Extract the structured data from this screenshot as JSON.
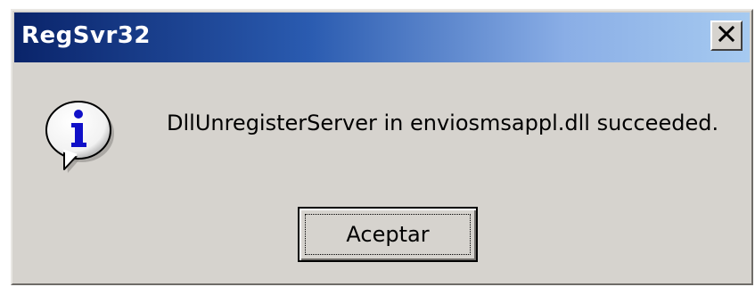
{
  "window": {
    "title": "RegSvr32",
    "close_label": "✕",
    "close_icon": "close-icon"
  },
  "dialog": {
    "icon": "info-icon",
    "message": "DllUnregisterServer in enviosmsappl.dll succeeded.",
    "ok_label": "Aceptar"
  },
  "colors": {
    "titlebar_start": "#0a246a",
    "titlebar_end": "#a6caf0",
    "face": "#d6d3ce",
    "info_blue": "#1010c8"
  }
}
